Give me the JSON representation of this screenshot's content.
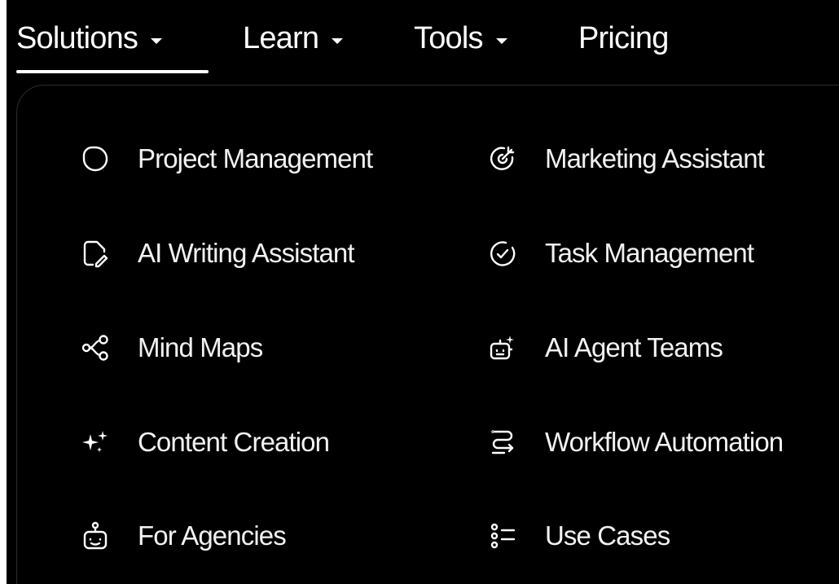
{
  "nav": {
    "items": [
      {
        "label": "Solutions",
        "has_caret": true,
        "active": true
      },
      {
        "label": "Learn",
        "has_caret": true,
        "active": false
      },
      {
        "label": "Tools",
        "has_caret": true,
        "active": false
      },
      {
        "label": "Pricing",
        "has_caret": false,
        "active": false
      }
    ]
  },
  "dropdown": {
    "left_column": [
      {
        "label": "Project Management",
        "icon": "pie-chart-icon"
      },
      {
        "label": "AI Writing Assistant",
        "icon": "document-pen-icon"
      },
      {
        "label": "Mind Maps",
        "icon": "mind-map-icon"
      },
      {
        "label": "Content Creation",
        "icon": "sparkles-icon"
      },
      {
        "label": "For Agencies",
        "icon": "robot-icon"
      }
    ],
    "right_column": [
      {
        "label": "Marketing Assistant",
        "icon": "target-arrow-icon"
      },
      {
        "label": "Task Management",
        "icon": "check-circle-icon"
      },
      {
        "label": "AI Agent Teams",
        "icon": "bot-team-icon"
      },
      {
        "label": "Workflow Automation",
        "icon": "workflow-icon"
      },
      {
        "label": "Use Cases",
        "icon": "list-icon"
      }
    ]
  },
  "colors": {
    "background": "#000000",
    "text": "#ffffff",
    "panel_border": "#2c2c2c"
  }
}
